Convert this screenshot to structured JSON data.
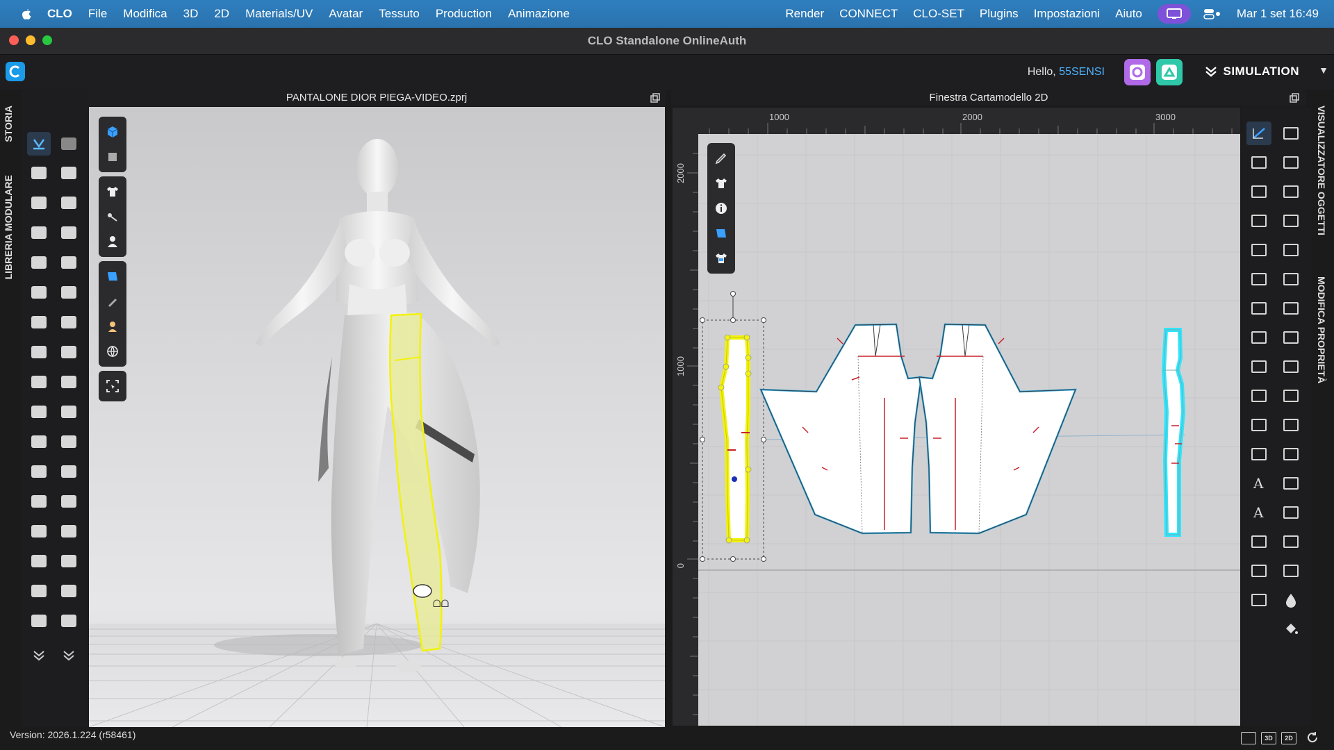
{
  "menubar": {
    "app_name": "CLO",
    "items": [
      "File",
      "Modifica",
      "3D",
      "2D",
      "Materials/UV",
      "Avatar",
      "Tessuto",
      "Production",
      "Animazione"
    ],
    "right_items": [
      "Render",
      "CONNECT",
      "CLO-SET",
      "Plugins",
      "Impostazioni",
      "Aiuto"
    ],
    "clock": "Mar 1 set  16:49"
  },
  "window": {
    "title": "CLO Standalone OnlineAuth"
  },
  "header": {
    "greeting": "Hello,",
    "username": "55SENSI",
    "mode": "SIMULATION"
  },
  "left_tabs": [
    "STORIA",
    "LIBRERIA MODULARE"
  ],
  "right_tabs": [
    "VISUALIZZATORE OGGETTI",
    "MODIFICA PROPRIETÀ"
  ],
  "pane3d": {
    "title": "PANTALONE DIOR PIEGA-VIDEO.zprj"
  },
  "pane2d": {
    "title": "Finestra Cartamodello 2D",
    "ruler_top": [
      "1000",
      "2000",
      "3000"
    ],
    "ruler_left": [
      "2000",
      "1000",
      "0"
    ]
  },
  "status": {
    "version": "Version: 2026.1.224 (r58461)",
    "icons": [
      "split-view",
      "3D",
      "2D",
      "refresh"
    ]
  },
  "colors": {
    "menubar": "#2a72ad",
    "accent_blue": "#4fb3ff",
    "selection_yellow": "#f2f20a",
    "piece_outline": "#2aa6e0",
    "cyan_piece": "#2ee6ff"
  }
}
